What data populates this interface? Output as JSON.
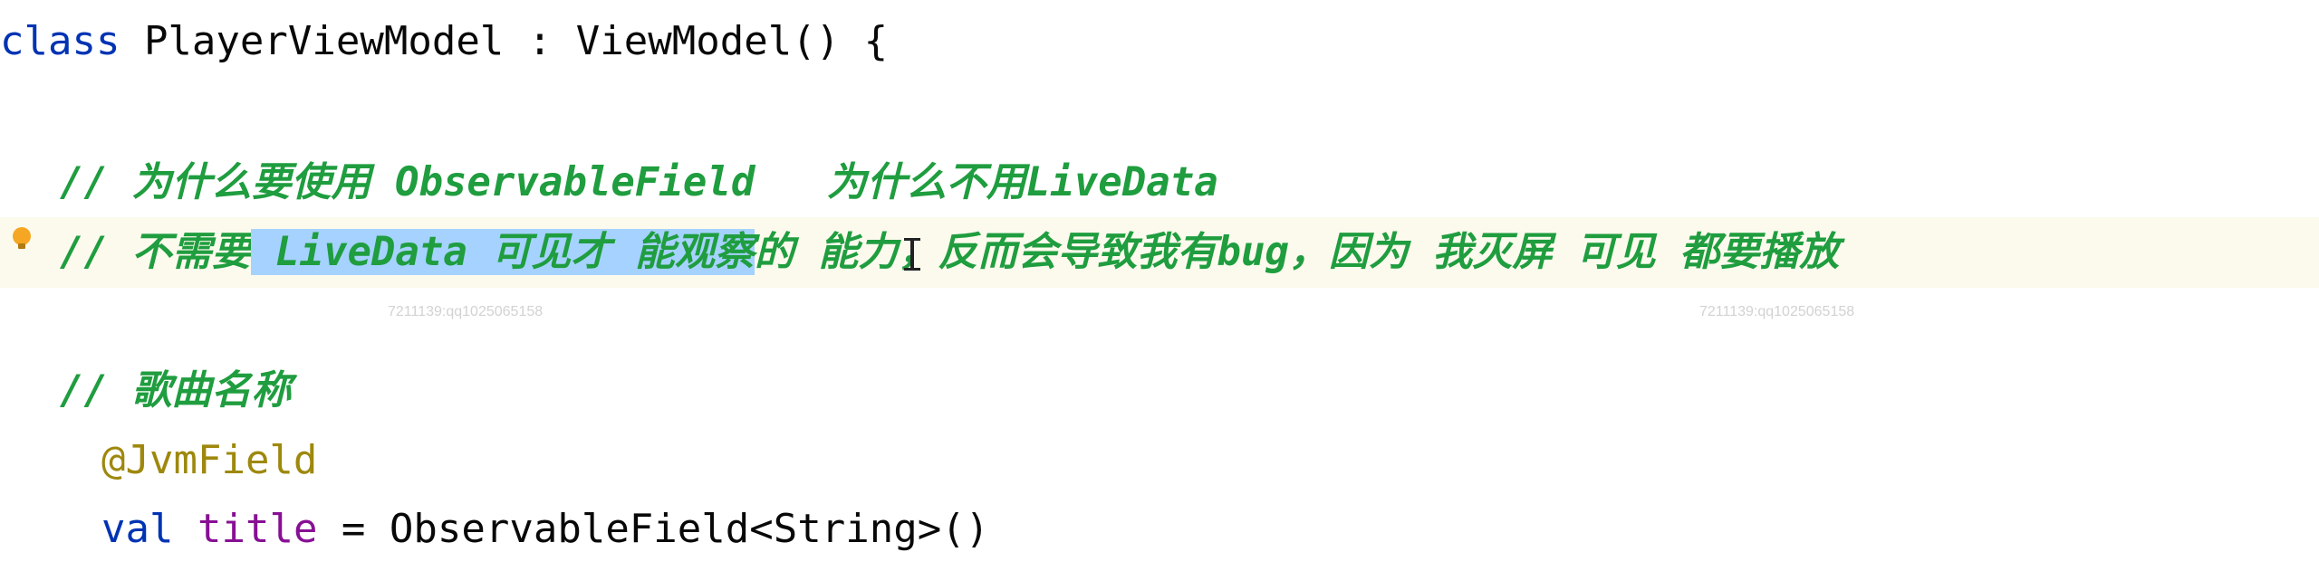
{
  "editor": {
    "line_class": {
      "kw": "class",
      "rest": " PlayerViewModel : ViewModel() {"
    },
    "comment1": "// 为什么要使用 ObservableField   为什么不用LiveData",
    "comment2": {
      "pre": "// 不需要",
      "selected": " LiveData 可见才 能观察",
      "post": "的 能力，反而会导致我有bug，因为 我灭屏 可见 都要播放"
    },
    "comment3": "// 歌曲名称",
    "annotation": "@JvmField",
    "line_val": {
      "kw": "val",
      "prop": "title",
      "rest": " = ObservableField<String>()"
    }
  },
  "gutter": {
    "icon": "lightbulb-icon"
  },
  "watermarks": [
    "7211139:qq1025065158",
    "7211139:qq1025065158"
  ],
  "colors": {
    "keyword": "#0033b3",
    "comment": "#1f9d3f",
    "annotation": "#9e880d",
    "property": "#871094",
    "selection": "#a6d2ff",
    "current_line": "#fcfaed"
  }
}
